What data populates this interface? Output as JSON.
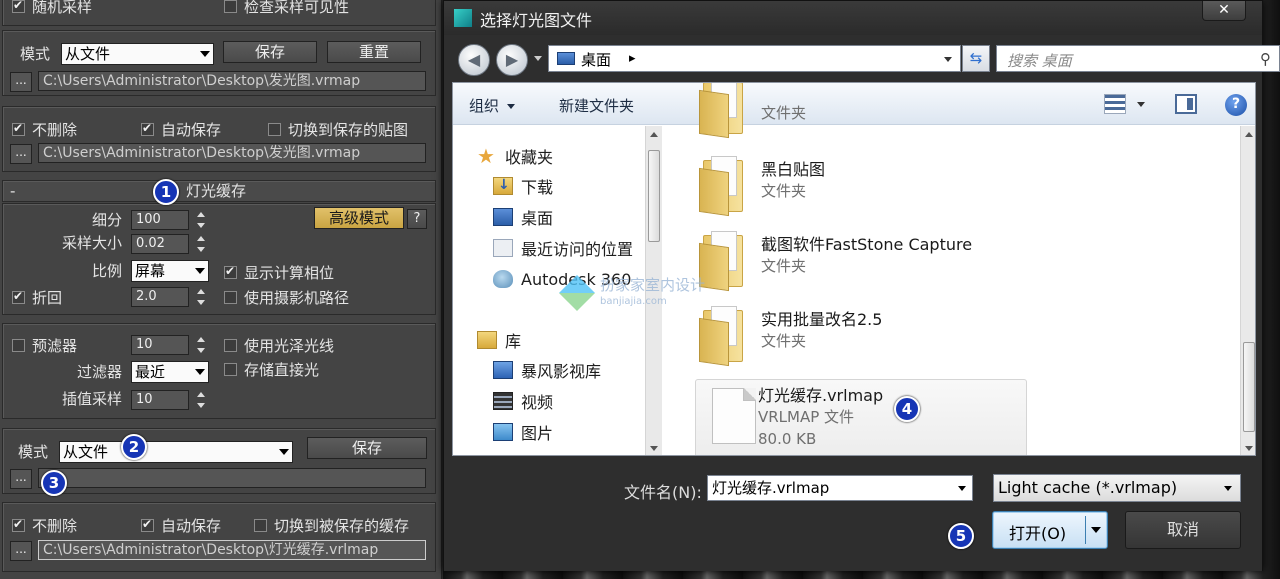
{
  "left_panel": {
    "top_row": {
      "random_sample": "随机采样",
      "check_visibility": "检查采样可见性"
    },
    "irradiance": {
      "mode_label": "模式",
      "mode_value": "从文件",
      "save_label": "保存",
      "reset_label": "重置",
      "dots": "...",
      "file_path": "C:\\Users\\Administrator\\Desktop\\发光图.vrmap",
      "dont_delete": "不删除",
      "auto_save": "自动保存",
      "switch_to_saved": "切换到保存的贴图",
      "auto_save_path": "C:\\Users\\Administrator\\Desktop\\发光图.vrmap"
    },
    "rollout_title": "灯光缓存",
    "rollout_minus": "-",
    "advanced_mode": "高级模式",
    "help": "?",
    "subdivs_label": "细分",
    "subdivs_value": "100",
    "sample_size_label": "采样大小",
    "sample_size_value": "0.02",
    "scale_label": "比例",
    "scale_value": "屏幕",
    "show_calc_phase": "显示计算相位",
    "retrace": "折回",
    "retrace_value": "2.0",
    "use_camera_path": "使用摄影机路径",
    "prefilter": "预滤器",
    "prefilter_value": "10",
    "use_glossy_rays": "使用光泽光线",
    "filter_label": "过滤器",
    "filter_value": "最近",
    "store_direct_light": "存储直接光",
    "interp_samples_label": "插值采样",
    "interp_samples_value": "10",
    "lc_mode_label": "模式",
    "lc_mode_value": "从文件",
    "lc_save_label": "保存",
    "lc_dots": "...",
    "lc_dont_delete": "不删除",
    "lc_auto_save": "自动保存",
    "lc_switch_to_saved": "切换到被保存的缓存",
    "lc_auto_save_path": "C:\\Users\\Administrator\\Desktop\\灯光缓存.vrlmap"
  },
  "badges": [
    "1",
    "2",
    "3",
    "4",
    "5"
  ],
  "dialog": {
    "title": "选择灯光图文件",
    "close": "✕",
    "address": "桌面",
    "address_sep": "▸",
    "search_placeholder": "搜索 桌面",
    "organize": "组织",
    "new_folder": "新建文件夹",
    "help": "?",
    "nav_items": [
      {
        "label": "收藏夹",
        "icon": "star-icon"
      },
      {
        "label": "下载",
        "icon": "downloads-icon"
      },
      {
        "label": "桌面",
        "icon": "desktop-icon"
      },
      {
        "label": "最近访问的位置",
        "icon": "recent-places-icon"
      },
      {
        "label": "Autodesk 360",
        "icon": "autodesk-cloud-icon"
      },
      {
        "label": "库",
        "icon": "library-icon"
      },
      {
        "label": "暴风影视库",
        "icon": "video-library-icon"
      },
      {
        "label": "视频",
        "icon": "film-icon"
      },
      {
        "label": "图片",
        "icon": "pictures-icon"
      }
    ],
    "files": [
      {
        "name": "黑白贴图",
        "type": "文件夹"
      },
      {
        "name": "截图软件FastStone Capture",
        "type": "文件夹"
      },
      {
        "name": "实用批量改名2.5",
        "type": "文件夹"
      }
    ],
    "partial_folder_type": "文件夹",
    "selected_file": {
      "name": "灯光缓存.vrlmap",
      "type": "VRLMAP 文件",
      "size": "80.0 KB"
    },
    "filename_label": "文件名(N):",
    "filename_value": "灯光缓存.vrlmap",
    "filetype_value": "Light cache (*.vrlmap)",
    "open_label": "打开(O)",
    "cancel_label": "取消"
  },
  "watermark": {
    "text": "扮家家室内设计",
    "sub": "banjiajia.com"
  }
}
